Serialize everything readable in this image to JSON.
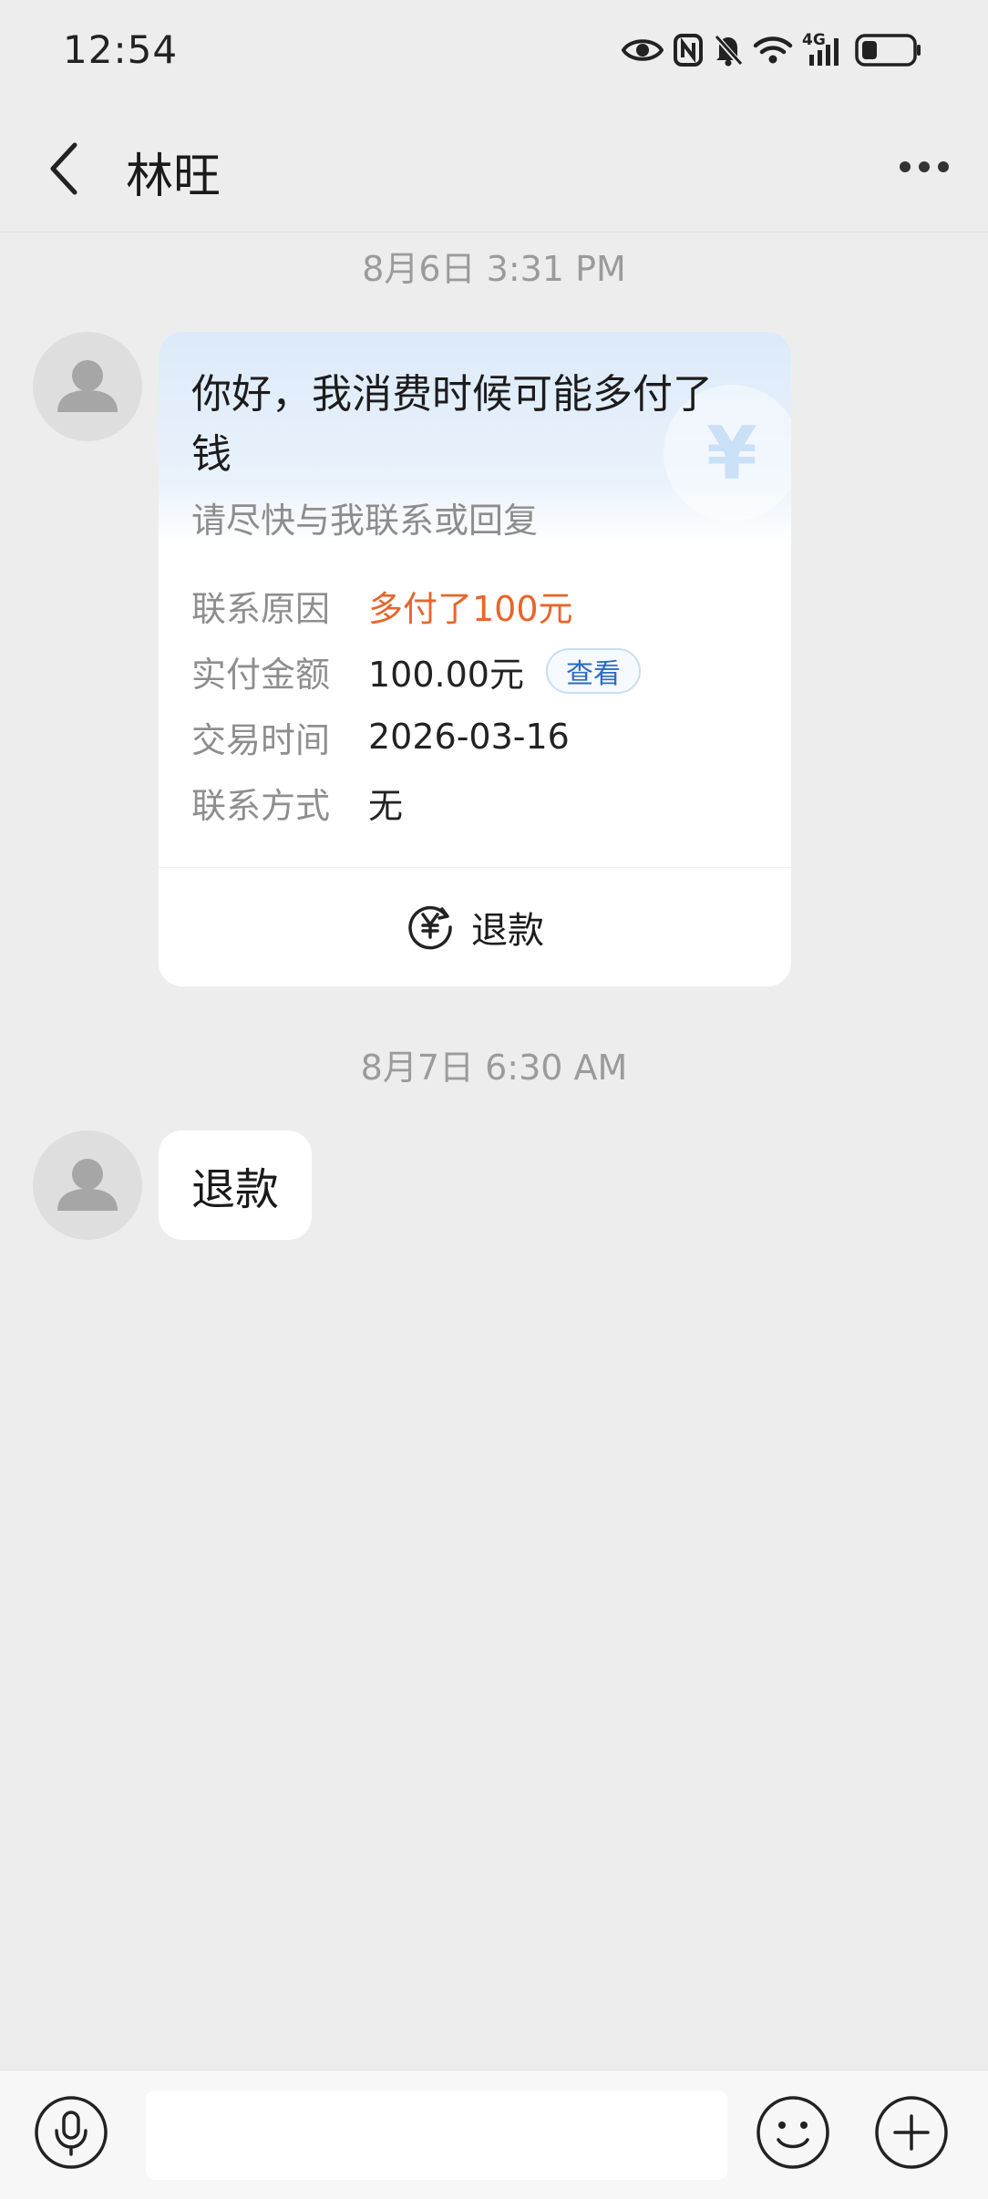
{
  "status_bar": {
    "time": "12:54",
    "network_label": "4G",
    "icons": [
      "eye-icon",
      "nfc-icon",
      "bell-muted-icon",
      "wifi-icon",
      "signal-4g-icon",
      "battery-icon"
    ]
  },
  "header": {
    "back_icon": "chevron-left-icon",
    "title": "林旺",
    "more_icon": "more-dots-icon"
  },
  "messages": [
    {
      "timestamp": "8月6日 3:31 PM",
      "type": "card",
      "card": {
        "title": "你好，我消费时候可能多付了钱",
        "subtitle": "请尽快与我联系或回复",
        "watermark": "¥",
        "fields": [
          {
            "label": "联系原因",
            "value": "多付了100元"
          },
          {
            "label": "实付金额",
            "value": "100.00元",
            "action": "查看"
          },
          {
            "label": "交易时间",
            "value": "2026-03-16"
          },
          {
            "label": "联系方式",
            "value": "无"
          }
        ],
        "action_icon": "yuan-refund-icon",
        "action_label": "退款"
      }
    },
    {
      "timestamp": "8月7日 6:30 AM",
      "type": "text",
      "text": "退款"
    }
  ],
  "composer": {
    "mic_icon": "microphone-icon",
    "input_value": "",
    "emoji_icon": "smiley-icon",
    "plus_icon": "plus-circle-icon"
  },
  "colors": {
    "background": "#ededed",
    "accent_orange": "#e8652a",
    "link_blue": "#2a6bc5",
    "card_header": "#dceaf9"
  }
}
